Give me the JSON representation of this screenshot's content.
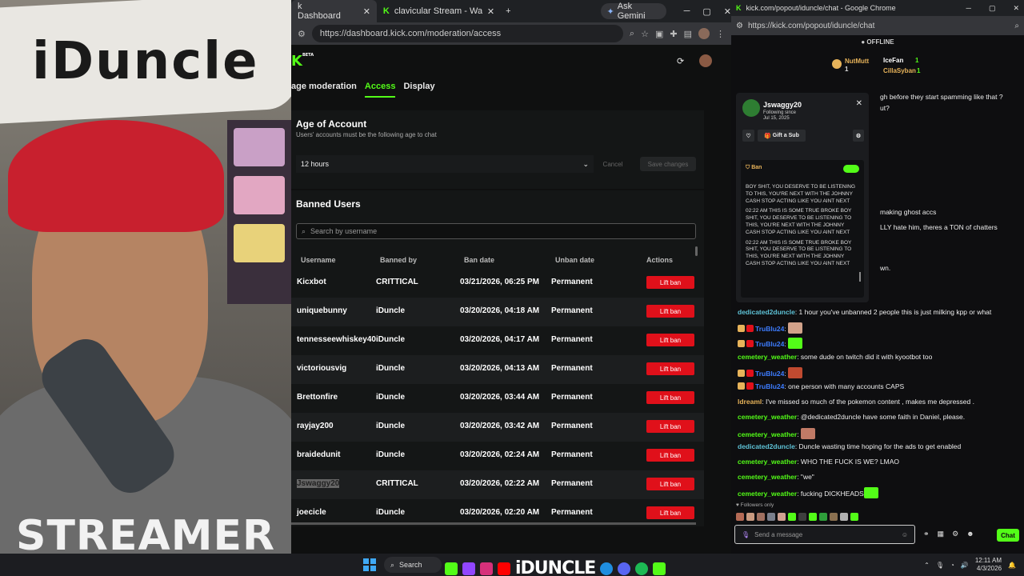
{
  "webcam": {
    "board_text": "iDuncle",
    "shirt_text": "STREAMER"
  },
  "win1": {
    "tabs": [
      {
        "label": "k Dashboard",
        "active": true
      },
      {
        "label": "clavicular Stream - Watch Live",
        "active": false
      }
    ],
    "gemini_label": "Ask Gemini",
    "url": "https://dashboard.kick.com/moderation/access",
    "logo_badge": "BETA",
    "nav": [
      "age moderation",
      "Access",
      "Display"
    ],
    "age": {
      "title": "Age of Account",
      "subtitle": "Users' accounts must be the following age to chat",
      "selected": "12 hours",
      "cancel": "Cancel",
      "save": "Save changes"
    },
    "banned": {
      "title": "Banned Users",
      "search_placeholder": "Search by username",
      "columns": [
        "Username",
        "Banned by",
        "Ban date",
        "Unban date",
        "Actions"
      ],
      "lift_label": "Lift ban",
      "rows": [
        {
          "user": "Kicxbot",
          "by": "CRITTICAL",
          "date": "03/21/2026, 06:25 PM",
          "unban": "Permanent"
        },
        {
          "user": "uniquebunny",
          "by": "iDuncle",
          "date": "03/20/2026, 04:18 AM",
          "unban": "Permanent"
        },
        {
          "user": "tennesseewhiskey40",
          "by": "iDuncle",
          "date": "03/20/2026, 04:17 AM",
          "unban": "Permanent"
        },
        {
          "user": "victoriousvig",
          "by": "iDuncle",
          "date": "03/20/2026, 04:13 AM",
          "unban": "Permanent"
        },
        {
          "user": "Brettonfire",
          "by": "iDuncle",
          "date": "03/20/2026, 03:44 AM",
          "unban": "Permanent"
        },
        {
          "user": "rayjay200",
          "by": "iDuncle",
          "date": "03/20/2026, 03:42 AM",
          "unban": "Permanent"
        },
        {
          "user": "braidedunit",
          "by": "iDuncle",
          "date": "03/20/2026, 02:24 AM",
          "unban": "Permanent"
        },
        {
          "user": "Jswaggy20",
          "by": "CRITTICAL",
          "date": "03/20/2026, 02:22 AM",
          "unban": "Permanent"
        },
        {
          "user": "joecicle",
          "by": "iDuncle",
          "date": "03/20/2026, 02:20 AM",
          "unban": "Permanent"
        }
      ]
    }
  },
  "win2": {
    "title": "kick.com/popout/iduncle/chat - Google Chrome",
    "url": "https://kick.com/popout/iduncle/chat",
    "status": "OFFLINE",
    "leaderboard": [
      {
        "name": "NutMutt",
        "count": "1"
      },
      {
        "name": "IceFan",
        "count": "1"
      },
      {
        "name": "CillaSyban",
        "count": "1"
      }
    ],
    "usercard": {
      "name": "Jswaggy20",
      "following_label": "Following since",
      "following_date": "Jul 15, 2025",
      "gift": "Gift a Sub",
      "ban_label": "Ban",
      "messages": [
        "BOY SHIT, YOU DESERVE TO BE LISTENING TO THIS, YOU'RE NEXT WITH THE JOHNNY CASH STOP ACTING LIKE YOU AINT NEXT",
        "02:22 AM THIS IS SOME TRUE BROKE BOY SHIT, YOU DESERVE TO BE LISTENING TO THIS, YOU'RE NEXT WITH THE JOHNNY CASH STOP ACTING LIKE YOU AINT NEXT",
        "02:22 AM THIS IS SOME TRUE BROKE BOY SHIT, YOU DESERVE TO BE LISTENING TO THIS, YOU'RE NEXT WITH THE JOHNNY CASH STOP ACTING LIKE YOU AINT NEXT"
      ]
    },
    "partials": [
      "gh before they start spamming like that ?",
      "ut?",
      "making ghost accs",
      "LLY hate him, theres a TON of chatters",
      "wn."
    ],
    "chat": [
      {
        "user": "dedicated2duncle",
        "text": "1 hour you've unbanned 2 people this is just milking kpp or what",
        "color": "#5ec2d6"
      },
      {
        "user": "TruBlu24",
        "text": "",
        "color": "#3d7cff"
      },
      {
        "user": "TruBlu24",
        "text": "",
        "color": "#3d7cff"
      },
      {
        "user": "cemetery_weather",
        "text": "some dude on twitch did it with kyootbot too",
        "color": "#53fc18"
      },
      {
        "user": "TruBlu24",
        "text": "",
        "color": "#3d7cff"
      },
      {
        "user": "TruBlu24",
        "text": "one person with many accounts CAPS",
        "color": "#3d7cff"
      },
      {
        "user": "ldreaml",
        "text": "I've missed so much of the pokemon content , makes me depressed .",
        "color": "#e7b35a"
      },
      {
        "user": "cemetery_weather",
        "text": "@dedicated2duncle have some faith in Daniel, please.",
        "color": "#53fc18"
      },
      {
        "user": "cemetery_weather",
        "text": "",
        "color": "#53fc18"
      },
      {
        "user": "dedicated2duncle",
        "text": "Duncle wasting time hoping for the ads to get enabled",
        "color": "#5ec2d6"
      },
      {
        "user": "cemetery_weather",
        "text": "WHO THE FUCK IS WE? LMAO",
        "color": "#53fc18"
      },
      {
        "user": "cemetery_weather",
        "text": "\"we\"",
        "color": "#53fc18"
      },
      {
        "user": "cemetery_weather",
        "text": "fucking DICKHEADS",
        "color": "#53fc18"
      }
    ],
    "followers_only": "Followers only",
    "input_placeholder": "Send a message",
    "chat_button": "Chat"
  },
  "taskbar": {
    "search": "Search",
    "brand": "iDUNCLE",
    "time": "12:11 AM",
    "date": "4/3/2026"
  },
  "colors": {
    "kick_green": "#53fc18",
    "lift_red": "#e0101a"
  }
}
